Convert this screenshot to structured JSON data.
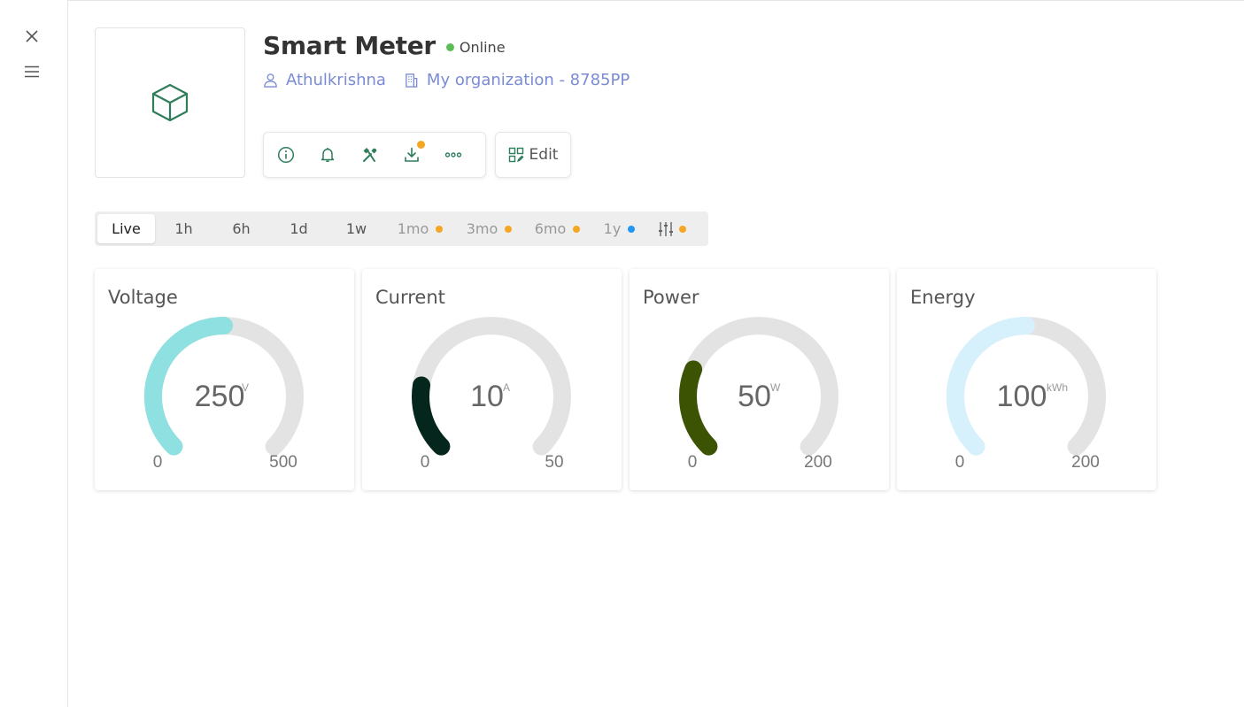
{
  "rail": {
    "close_icon": "close-icon",
    "menu_icon": "menu-icon"
  },
  "device": {
    "icon": "cube-icon",
    "title": "Smart Meter",
    "status": "Online",
    "status_color": "#5cbd54",
    "owner": "Athulkrishna",
    "organization": "My organization - 8785PP",
    "link_color": "#7a8bd3"
  },
  "actions": {
    "buttons": [
      "info-icon",
      "bell-icon",
      "tools-icon",
      "download-icon",
      "more-icon"
    ],
    "edit_label": "Edit",
    "accent": "#2e7d5b",
    "download_badge_color": "#f5a623"
  },
  "time_ranges": [
    {
      "label": "Live",
      "active": true
    },
    {
      "label": "1h"
    },
    {
      "label": "6h"
    },
    {
      "label": "1d"
    },
    {
      "label": "1w"
    },
    {
      "label": "1mo",
      "dot": "#f5a623",
      "muted": true
    },
    {
      "label": "3mo",
      "dot": "#f5a623",
      "muted": true
    },
    {
      "label": "6mo",
      "dot": "#f5a623",
      "muted": true
    },
    {
      "label": "1y",
      "dot": "#2196f3",
      "muted": true
    },
    {
      "label": "",
      "icon": "sliders-icon",
      "dot": "#f5a623"
    }
  ],
  "gauges": [
    {
      "title": "Voltage",
      "value": "250",
      "unit": "V",
      "min": "0",
      "max": "500",
      "fill": 0.5,
      "color": "#8fe0e1"
    },
    {
      "title": "Current",
      "value": "10",
      "unit": "A",
      "min": "0",
      "max": "50",
      "fill": 0.2,
      "color": "#05261c"
    },
    {
      "title": "Power",
      "value": "50",
      "unit": "W",
      "min": "0",
      "max": "200",
      "fill": 0.25,
      "color": "#3c5304"
    },
    {
      "title": "Energy",
      "value": "100",
      "unit": "kWh",
      "min": "0",
      "max": "200",
      "fill": 0.5,
      "color": "#d6f1fb"
    }
  ]
}
